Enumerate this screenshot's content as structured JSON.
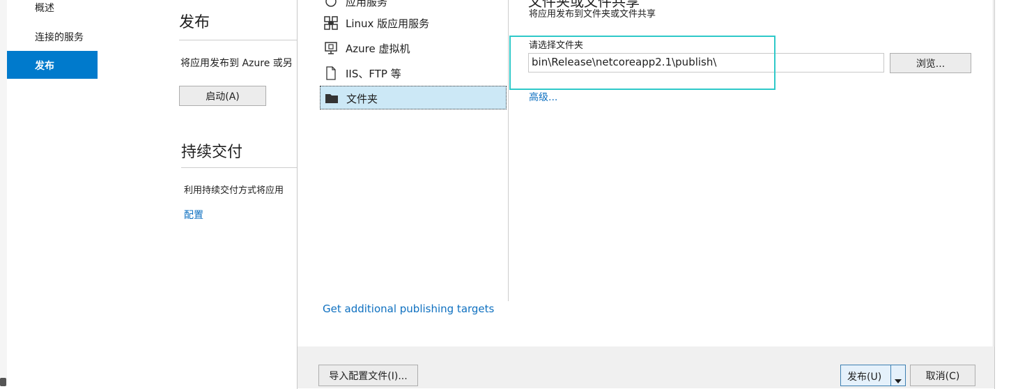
{
  "nav": {
    "items": [
      "概述",
      "连接的服务"
    ],
    "active": "发布"
  },
  "publish_page": {
    "title": "发布",
    "description": "将应用发布到 Azure 或另",
    "start_button": "启动(A)",
    "cd_title": "持续交付",
    "cd_description": "利用持续交付方式将应用",
    "configure_link": "配置"
  },
  "dialog": {
    "targets": [
      {
        "label": "应用服务",
        "icon": "app-service-icon"
      },
      {
        "label": "Linux 版应用服务",
        "icon": "linux-app-service-icon"
      },
      {
        "label": "Azure 虚拟机",
        "icon": "virtual-machine-icon"
      },
      {
        "label": "IIS、FTP 等",
        "icon": "file-icon"
      },
      {
        "label": "文件夹",
        "icon": "folder-icon"
      }
    ],
    "selected_target": "文件夹",
    "additional_targets_link": "Get additional publishing targets",
    "panel_title": "文件夹或文件共享",
    "panel_subtitle": "将应用发布到文件夹或文件共享",
    "folder_label": "请选择文件夹",
    "folder_value": "bin\\Release\\netcoreapp2.1\\publish\\",
    "browse_button": "浏览...",
    "advanced_link": "高级...",
    "import_button": "导入配置文件(I)...",
    "publish_button": "发布(U)",
    "cancel_button": "取消(C)"
  },
  "colors": {
    "accent": "#007acc",
    "selection": "#cce8f6",
    "highlight_box": "#2ec9c9",
    "link": "#0e70c0"
  }
}
